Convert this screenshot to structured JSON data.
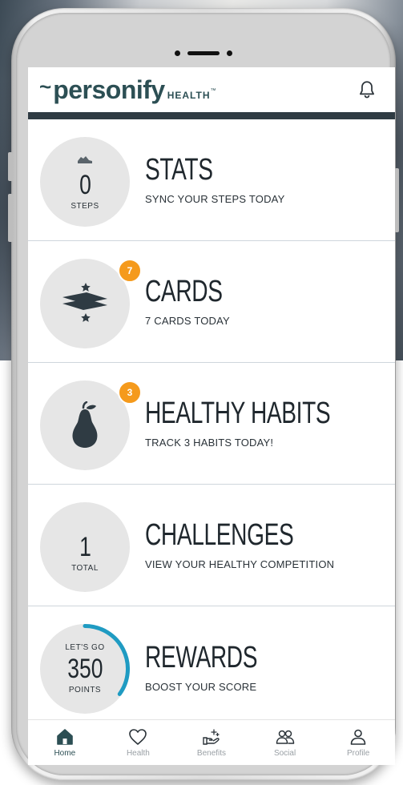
{
  "brand": {
    "name": "personify",
    "suffix": "HEALTH",
    "tm": "™",
    "color": "#2c4f54"
  },
  "rows": {
    "stats": {
      "value": "0",
      "unit": "STEPS",
      "title": "STATS",
      "subtitle": "SYNC YOUR STEPS TODAY",
      "icon": "sneaker-icon"
    },
    "cards": {
      "badge": "7",
      "title": "CARDS",
      "subtitle": "7 CARDS TODAY",
      "icon": "cards-icon"
    },
    "habits": {
      "badge": "3",
      "title": "HEALTHY HABITS",
      "subtitle": "TRACK 3 HABITS TODAY!",
      "icon": "pear-icon"
    },
    "challenges": {
      "value": "1",
      "unit": "TOTAL",
      "title": "CHALLENGES",
      "subtitle": "VIEW YOUR HEALTHY COMPETITION"
    },
    "rewards": {
      "top": "LET'S GO",
      "value": "350",
      "unit": "POINTS",
      "title": "REWARDS",
      "subtitle": "BOOST YOUR SCORE",
      "progress": 0.35
    }
  },
  "tabs": {
    "home": "Home",
    "health": "Health",
    "benefits": "Benefits",
    "social": "Social",
    "profile": "Profile"
  },
  "colors": {
    "badge": "#f59a1c",
    "accent": "#1f9bc2",
    "header_bar": "#2f3b43",
    "text": "#1f272d"
  }
}
